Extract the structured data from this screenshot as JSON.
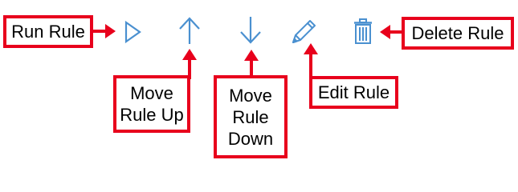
{
  "toolbar": {
    "buttons": [
      {
        "id": "run",
        "icon": "play-triangle-icon"
      },
      {
        "id": "move-up",
        "icon": "arrow-up-icon"
      },
      {
        "id": "move-down",
        "icon": "arrow-down-icon"
      },
      {
        "id": "edit",
        "icon": "pencil-icon"
      },
      {
        "id": "delete",
        "icon": "trash-icon"
      }
    ]
  },
  "callouts": {
    "run_rule": "Run Rule",
    "move_rule_up": "Move\nRule Up",
    "move_rule_down": "Move\nRule\nDown",
    "edit_rule": "Edit Rule",
    "delete_rule": "Delete Rule"
  },
  "colors": {
    "icon": "#4a90d0",
    "callout_border": "#e8001c",
    "arrow": "#e8001c"
  }
}
